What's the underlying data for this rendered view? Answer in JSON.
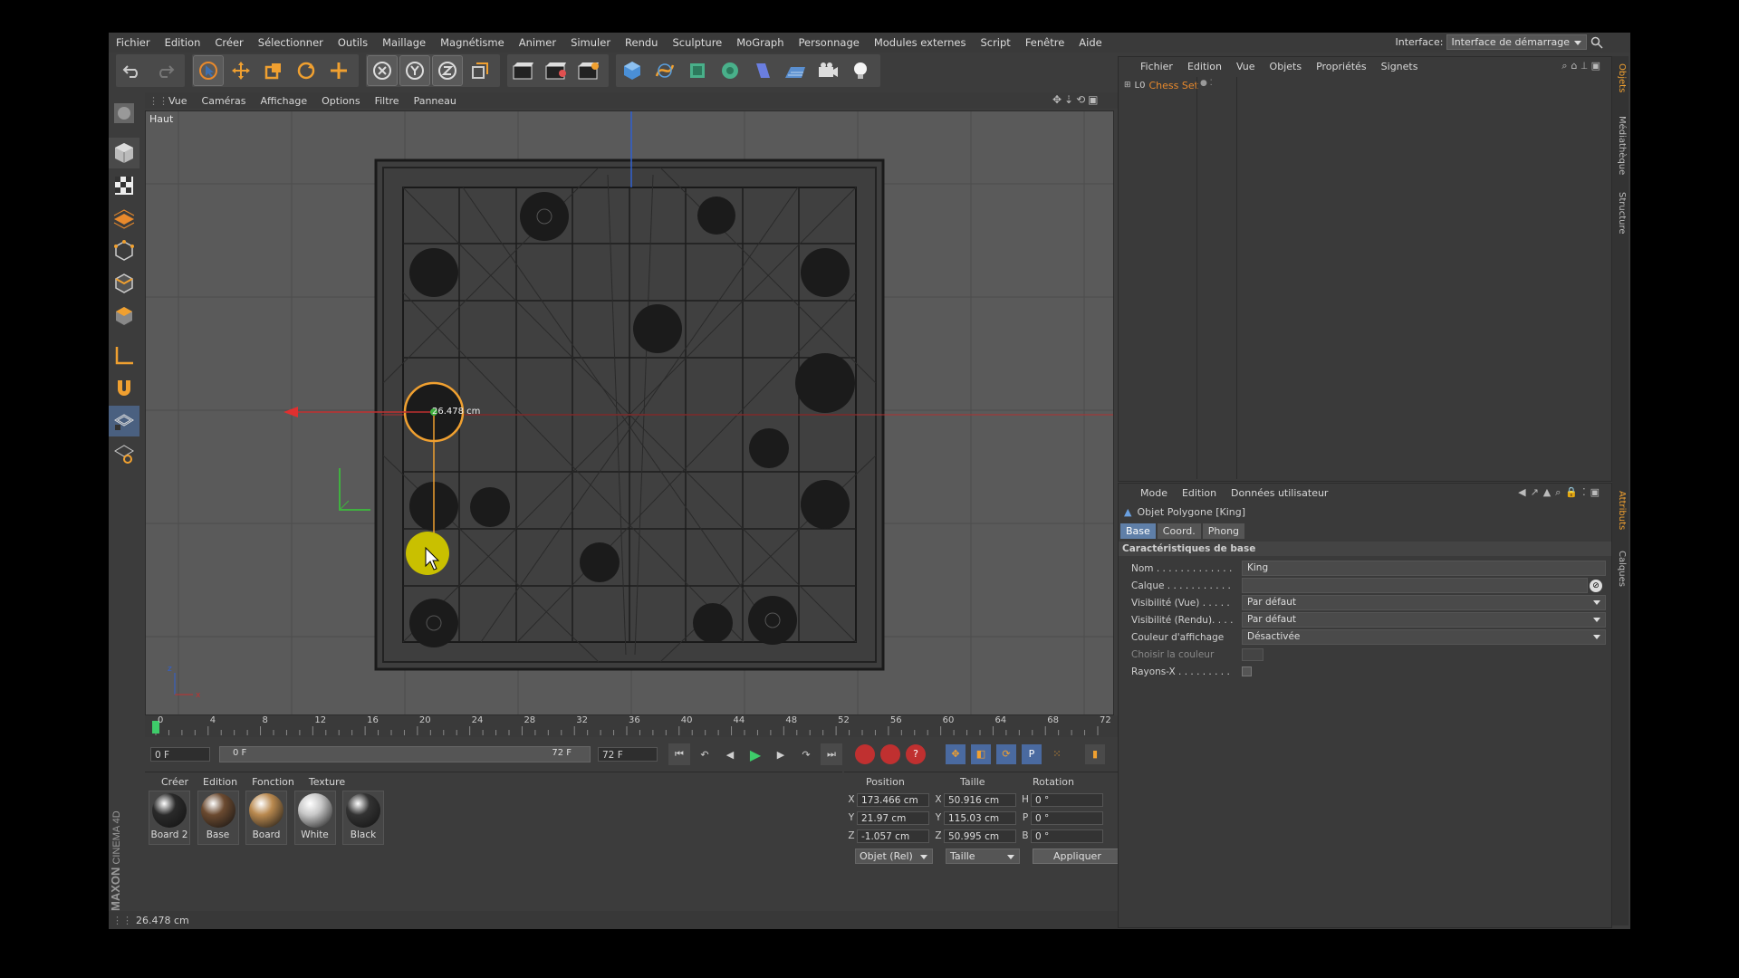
{
  "menubar": {
    "items": [
      "Fichier",
      "Edition",
      "Créer",
      "Sélectionner",
      "Outils",
      "Maillage",
      "Magnétisme",
      "Animer",
      "Simuler",
      "Rendu",
      "Sculpture",
      "MoGraph",
      "Personnage",
      "Modules externes",
      "Script",
      "Fenêtre",
      "Aide"
    ],
    "interface_label": "Interface:",
    "interface_value": "Interface de démarrage"
  },
  "viewport": {
    "menu": [
      "Vue",
      "Caméras",
      "Affichage",
      "Options",
      "Filtre",
      "Panneau"
    ],
    "view_name": "Haut",
    "measure_label": "26.478 cm"
  },
  "timeline": {
    "ticks": [
      "0",
      "4",
      "8",
      "12",
      "16",
      "20",
      "24",
      "28",
      "32",
      "36",
      "40",
      "44",
      "48",
      "52",
      "56",
      "60",
      "64",
      "68",
      "72"
    ],
    "current_frame_right": "0 F",
    "start_frame": "0 F",
    "range_left": "0 F",
    "range_right": "72 F",
    "end_frame": "72 F"
  },
  "materials": {
    "menu": [
      "Créer",
      "Edition",
      "Fonction",
      "Texture"
    ],
    "items": [
      {
        "name": "Board 2",
        "color": "#2a2a2a"
      },
      {
        "name": "Base",
        "color": "#6b4a30"
      },
      {
        "name": "Board",
        "color": "#b9894f"
      },
      {
        "name": "White",
        "color": "#c8c8c8"
      },
      {
        "name": "Black",
        "color": "#333333"
      }
    ]
  },
  "coords": {
    "headers": [
      "Position",
      "Taille",
      "Rotation"
    ],
    "rows": [
      {
        "axis": "X",
        "pos": "173.466 cm",
        "size_axis": "X",
        "size": "50.916 cm",
        "rot_axis": "H",
        "rot": "0 °"
      },
      {
        "axis": "Y",
        "pos": "21.97 cm",
        "size_axis": "Y",
        "size": "115.03 cm",
        "rot_axis": "P",
        "rot": "0 °"
      },
      {
        "axis": "Z",
        "pos": "-1.057 cm",
        "size_axis": "Z",
        "size": "50.995 cm",
        "rot_axis": "B",
        "rot": "0 °"
      }
    ],
    "mode": "Objet (Rel)",
    "size_mode": "Taille",
    "apply": "Appliquer"
  },
  "object_manager": {
    "menu": [
      "Fichier",
      "Edition",
      "Vue",
      "Objets",
      "Propriétés",
      "Signets"
    ],
    "object_name": "Chess Set"
  },
  "attribute_manager": {
    "menu": [
      "Mode",
      "Edition",
      "Données utilisateur"
    ],
    "object_title": "Objet Polygone [King]",
    "tabs": [
      "Base",
      "Coord.",
      "Phong"
    ],
    "section": "Caractéristiques de base",
    "fields": [
      {
        "label": "Nom . . . . . . . . . . . . .",
        "value": "King",
        "type": "text"
      },
      {
        "label": "Calque . . . . . . . . . . .",
        "value": "",
        "type": "layer"
      },
      {
        "label": "Visibilité (Vue) . . . . .",
        "value": "Par défaut",
        "type": "dropdown"
      },
      {
        "label": "Visibilité (Rendu). . . .",
        "value": "Par défaut",
        "type": "dropdown"
      },
      {
        "label": "Couleur d'affichage",
        "value": "Désactivée",
        "type": "dropdown"
      },
      {
        "label": "Choisir la couleur",
        "value": "",
        "type": "color"
      },
      {
        "label": "Rayons-X . . . . . . . . .",
        "value": "",
        "type": "checkbox"
      }
    ]
  },
  "side_tabs": [
    "Objets",
    "Médiathèque",
    "Structure",
    "Attributs",
    "Calques"
  ],
  "status": {
    "text": "26.478 cm"
  },
  "brand": {
    "line1": "MAXON",
    "line2": "CINEMA 4D"
  }
}
